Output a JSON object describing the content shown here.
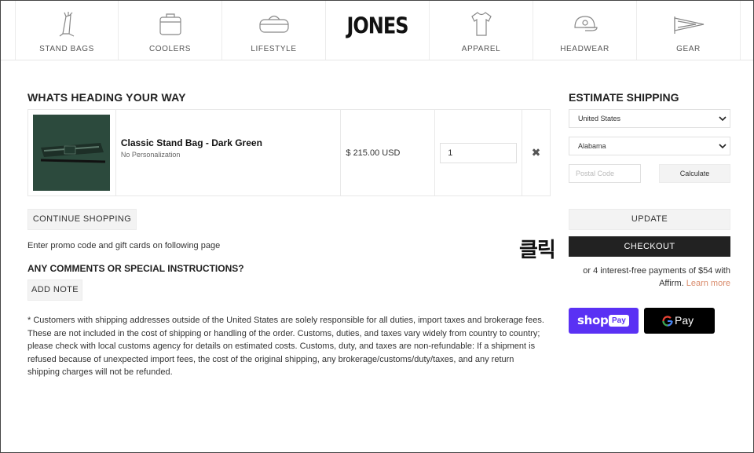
{
  "nav": {
    "items": [
      {
        "label": "STAND BAGS",
        "icon": "golf-bag-icon"
      },
      {
        "label": "COOLERS",
        "icon": "cooler-icon"
      },
      {
        "label": "LIFESTYLE",
        "icon": "duffel-bag-icon"
      },
      {
        "label": "",
        "icon": "jones-logo"
      },
      {
        "label": "APPAREL",
        "icon": "tshirt-icon"
      },
      {
        "label": "HEADWEAR",
        "icon": "cap-icon"
      },
      {
        "label": "GEAR",
        "icon": "pennant-icon"
      }
    ],
    "logo_text": "JONES"
  },
  "cart": {
    "heading": "WHATS HEADING YOUR WAY",
    "item": {
      "name": "Classic Stand Bag - Dark Green",
      "personalization": "No Personalization",
      "price": "$ 215.00 USD",
      "quantity": "1",
      "remove_glyph": "✖"
    },
    "continue_label": "CONTINUE SHOPPING",
    "promo_text": "Enter promo code and gift cards on following page",
    "comments_heading": "ANY COMMENTS OR SPECIAL INSTRUCTIONS?",
    "add_note_label": "ADD NOTE",
    "notice": "* Customers with shipping addresses outside of the United States are solely responsible for all duties, import taxes and brokerage fees. These are not included in the cost of shipping or handling of the order. Customs, duties, and taxes vary widely from country to country; please check with local customs agency for details on estimated costs. Customs, duty, and taxes are non-refundable: If a shipment is refused because of unexpected import fees, the cost of the original shipping, any brokerage/customs/duty/taxes, and any return shipping charges will not be refunded."
  },
  "shipping": {
    "heading": "ESTIMATE SHIPPING",
    "country": "United States",
    "state": "Alabama",
    "postal_placeholder": "Postal Code",
    "calculate_label": "Calculate"
  },
  "actions": {
    "update_label": "UPDATE",
    "checkout_label": "CHECKOUT",
    "annotation": "클릭",
    "affirm_text": "or 4 interest-free payments of $54 with",
    "affirm_brand": "Affirm.",
    "learn_more": "Learn more",
    "shoppay_label": "shop",
    "shoppay_badge": "Pay",
    "gpay_label": "Pay"
  },
  "colors": {
    "accent_link": "#d98a6a",
    "checkout_bg": "#222222",
    "shoppay_bg": "#5a31f4",
    "product_bg": "#2c4a3d"
  }
}
